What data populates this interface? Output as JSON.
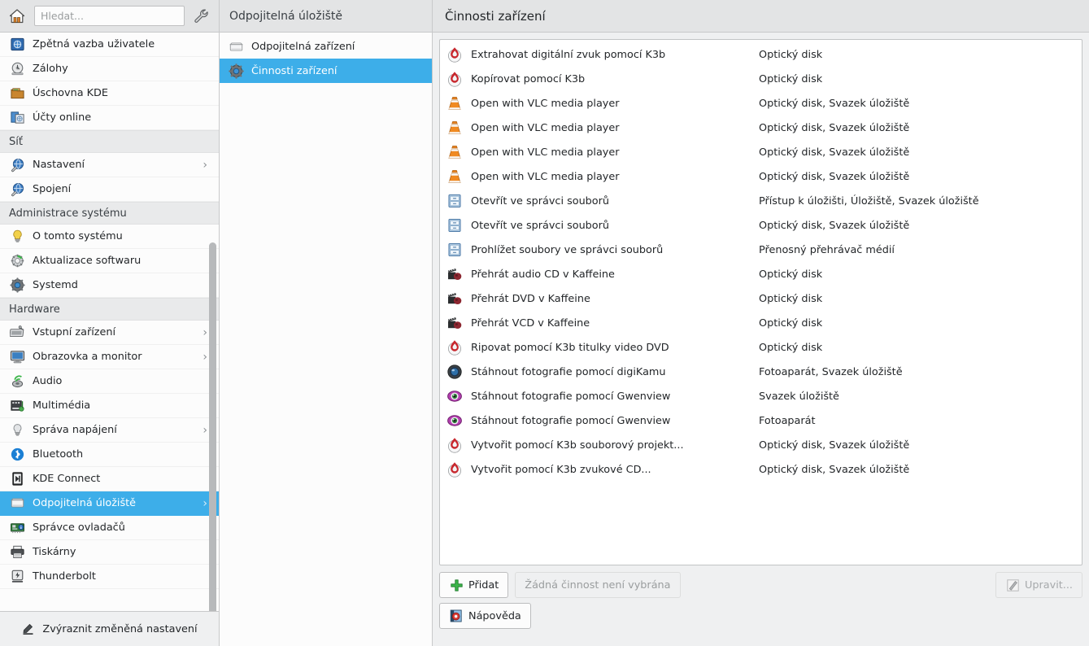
{
  "header": {
    "home_icon": "home-icon",
    "tools_icon": "wrench-icon",
    "search_placeholder": "Hledat...",
    "search_value": "",
    "mid_title": "Odpojitelná úložiště",
    "main_title": "Činnosti zařízení"
  },
  "colors": {
    "accent": "#3daee9",
    "window_bg": "#eff0f1",
    "header_bg": "#e3e4e5",
    "list_bg": "#ffffff",
    "text": "#232629",
    "disabled_text": "#9a9d9e"
  },
  "sidebar": {
    "items": [
      {
        "type": "item",
        "label": "Zpětná vazba uživatele",
        "icon": "user-feedback-icon",
        "arrow": false,
        "selected": false
      },
      {
        "type": "item",
        "label": "Zálohy",
        "icon": "backup-disk-icon",
        "arrow": false,
        "selected": false
      },
      {
        "type": "item",
        "label": "Úschovna KDE",
        "icon": "wallet-folder-icon",
        "arrow": false,
        "selected": false
      },
      {
        "type": "item",
        "label": "Účty online",
        "icon": "online-accounts-icon",
        "arrow": false,
        "selected": false
      },
      {
        "type": "section",
        "label": "Síť"
      },
      {
        "type": "item",
        "label": "Nastavení",
        "icon": "network-settings-icon",
        "arrow": true,
        "selected": false
      },
      {
        "type": "item",
        "label": "Spojení",
        "icon": "network-connection-icon",
        "arrow": false,
        "selected": false
      },
      {
        "type": "section",
        "label": "Administrace systému"
      },
      {
        "type": "item",
        "label": "O tomto systému",
        "icon": "lightbulb-icon",
        "arrow": false,
        "selected": false
      },
      {
        "type": "item",
        "label": "Aktualizace softwaru",
        "icon": "software-update-icon",
        "arrow": false,
        "selected": false
      },
      {
        "type": "item",
        "label": "Systemd",
        "icon": "systemd-gear-icon",
        "arrow": false,
        "selected": false
      },
      {
        "type": "section",
        "label": "Hardware"
      },
      {
        "type": "item",
        "label": "Vstupní zařízení",
        "icon": "input-devices-icon",
        "arrow": true,
        "selected": false
      },
      {
        "type": "item",
        "label": "Obrazovka a monitor",
        "icon": "display-monitor-icon",
        "arrow": true,
        "selected": false
      },
      {
        "type": "item",
        "label": "Audio",
        "icon": "audio-speaker-icon",
        "arrow": false,
        "selected": false
      },
      {
        "type": "item",
        "label": "Multimédia",
        "icon": "multimedia-icon",
        "arrow": false,
        "selected": false
      },
      {
        "type": "item",
        "label": "Správa napájení",
        "icon": "power-management-icon",
        "arrow": true,
        "selected": false
      },
      {
        "type": "item",
        "label": "Bluetooth",
        "icon": "bluetooth-icon",
        "arrow": false,
        "selected": false
      },
      {
        "type": "item",
        "label": "KDE Connect",
        "icon": "kde-connect-icon",
        "arrow": false,
        "selected": false
      },
      {
        "type": "item",
        "label": "Odpojitelná úložiště",
        "icon": "removable-storage-icon",
        "arrow": true,
        "selected": true
      },
      {
        "type": "item",
        "label": "Správce ovladačů",
        "icon": "driver-manager-icon",
        "arrow": false,
        "selected": false
      },
      {
        "type": "item",
        "label": "Tiskárny",
        "icon": "printer-icon",
        "arrow": false,
        "selected": false
      },
      {
        "type": "item",
        "label": "Thunderbolt",
        "icon": "thunderbolt-icon",
        "arrow": false,
        "selected": false
      }
    ],
    "footer": {
      "label": "Zvýraznit změněná nastavení",
      "icon": "highlighter-icon"
    }
  },
  "midcol": {
    "items": [
      {
        "label": "Odpojitelná zařízení",
        "icon": "removable-device-icon",
        "selected": false
      },
      {
        "label": "Činnosti zařízení",
        "icon": "device-actions-gear-icon",
        "selected": true
      }
    ]
  },
  "actions": {
    "rows": [
      {
        "name": "Extrahovat digitální zvuk pomocí K3b",
        "device": "Optický disk",
        "icon": "k3b-icon"
      },
      {
        "name": "Kopírovat pomocí K3b",
        "device": "Optický disk",
        "icon": "k3b-icon"
      },
      {
        "name": "Open with VLC media player",
        "device": "Optický disk, Svazek úložiště",
        "icon": "vlc-icon"
      },
      {
        "name": "Open with VLC media player",
        "device": "Optický disk, Svazek úložiště",
        "icon": "vlc-icon"
      },
      {
        "name": "Open with VLC media player",
        "device": "Optický disk, Svazek úložiště",
        "icon": "vlc-icon"
      },
      {
        "name": "Open with VLC media player",
        "device": "Optický disk, Svazek úložiště",
        "icon": "vlc-icon"
      },
      {
        "name": "Otevřít ve správci souborů",
        "device": "Přístup k úložišti, Úložiště, Svazek úložiště",
        "icon": "file-manager-icon"
      },
      {
        "name": "Otevřít ve správci souborů",
        "device": "Optický disk, Svazek úložiště",
        "icon": "file-manager-icon"
      },
      {
        "name": "Prohlížet soubory ve správci souborů",
        "device": "Přenosný přehrávač médií",
        "icon": "file-manager-icon"
      },
      {
        "name": "Přehrát audio CD v Kaffeine",
        "device": "Optický disk",
        "icon": "kaffeine-icon"
      },
      {
        "name": "Přehrát DVD v Kaffeine",
        "device": "Optický disk",
        "icon": "kaffeine-icon"
      },
      {
        "name": "Přehrát VCD v Kaffeine",
        "device": "Optický disk",
        "icon": "kaffeine-icon"
      },
      {
        "name": "Ripovat pomocí K3b titulky video DVD",
        "device": "Optický disk",
        "icon": "k3b-icon"
      },
      {
        "name": "Stáhnout fotografie pomocí digiKamu",
        "device": "Fotoaparát, Svazek úložiště",
        "icon": "digikam-icon"
      },
      {
        "name": "Stáhnout fotografie pomocí Gwenview",
        "device": "Svazek úložiště",
        "icon": "gwenview-icon"
      },
      {
        "name": "Stáhnout fotografie pomocí Gwenview",
        "device": "Fotoaparát",
        "icon": "gwenview-icon"
      },
      {
        "name": "Vytvořit pomocí K3b souborový projekt...",
        "device": "Optický disk, Svazek úložiště",
        "icon": "k3b-icon"
      },
      {
        "name": "Vytvořit pomocí K3b zvukové CD...",
        "device": "Optický disk, Svazek úložiště",
        "icon": "k3b-icon"
      }
    ]
  },
  "buttons": {
    "add": {
      "label": "Přidat",
      "icon": "plus-icon"
    },
    "no_selection": {
      "label": "Žádná činnost není vybrána"
    },
    "edit": {
      "label": "Upravit...",
      "icon": "pencil-icon"
    },
    "help": {
      "label": "Nápověda",
      "icon": "help-book-icon"
    }
  }
}
